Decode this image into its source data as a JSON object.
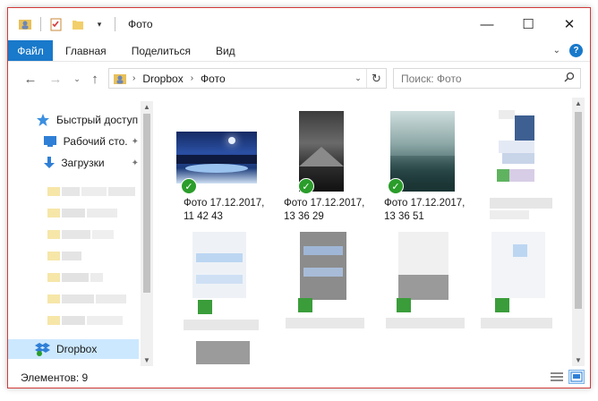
{
  "window": {
    "title": "Фото",
    "controls": {
      "minimize": "—",
      "maximize": "☐",
      "close": "✕"
    }
  },
  "ribbon": {
    "tabs": [
      "Файл",
      "Главная",
      "Поделиться",
      "Вид"
    ],
    "expand_icon": "chevron-down-icon",
    "help_icon": "help-icon"
  },
  "address": {
    "crumbs": [
      "Dropbox",
      "Фото"
    ],
    "search_placeholder": "Поиск: Фото"
  },
  "nav": {
    "items": [
      {
        "label": "Быстрый доступ",
        "icon": "star-icon"
      },
      {
        "label": "Рабочий сто.",
        "icon": "desktop-icon",
        "pinned": true
      },
      {
        "label": "Загрузки",
        "icon": "download-icon",
        "pinned": true
      },
      {
        "label": "Dropbox",
        "icon": "dropbox-icon",
        "selected": true
      }
    ]
  },
  "files": [
    {
      "caption_line1": "Фото 17.12.2017,",
      "caption_line2": "11 42 43",
      "synced": true
    },
    {
      "caption_line1": "Фото 17.12.2017,",
      "caption_line2": "13 36 29",
      "synced": true
    },
    {
      "caption_line1": "Фото 17.12.2017,",
      "caption_line2": "13 36 51",
      "synced": true
    }
  ],
  "status": {
    "count_text": "Элементов: 9"
  },
  "colors": {
    "accent": "#1979ca",
    "sync_check": "#2a9d2a",
    "window_border": "#d23a3a",
    "selected_nav": "#cce8ff"
  }
}
